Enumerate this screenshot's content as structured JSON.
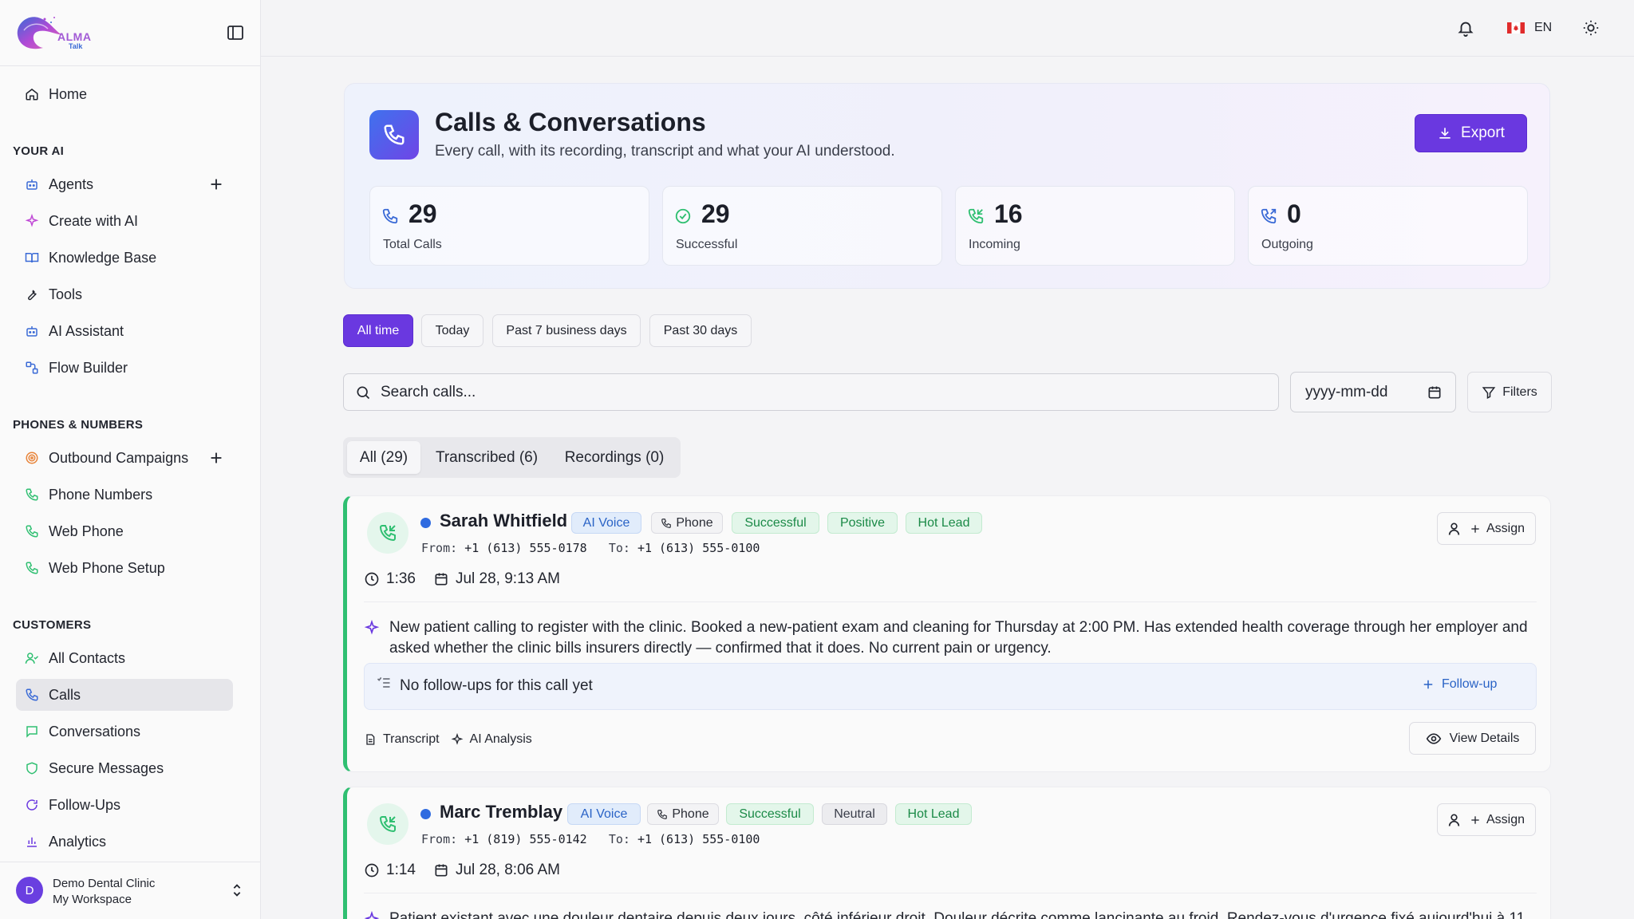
{
  "app": {
    "logo_text": "ALMA",
    "logo_sub": "Talk"
  },
  "sidebar": {
    "home": "Home",
    "section_ai": "YOUR AI",
    "ai_items": [
      "Agents",
      "Create with AI",
      "Knowledge Base",
      "Tools",
      "AI Assistant",
      "Flow Builder"
    ],
    "section_phones": "PHONES & NUMBERS",
    "phone_items": [
      "Outbound Campaigns",
      "Phone Numbers",
      "Web Phone",
      "Web Phone Setup"
    ],
    "section_customers": "CUSTOMERS",
    "customer_items": [
      "All Contacts",
      "Calls",
      "Conversations",
      "Secure Messages",
      "Follow-Ups",
      "Analytics"
    ],
    "active_item": "Calls",
    "workspace": {
      "initial": "D",
      "name": "Demo Dental Clinic",
      "sub": "My Workspace"
    }
  },
  "topbar": {
    "lang": "EN"
  },
  "header": {
    "title": "Calls & Conversations",
    "subtitle": "Every call, with its recording, transcript and what your AI understood.",
    "export_label": "Export",
    "stats": [
      {
        "value": "29",
        "label": "Total Calls",
        "icon": "phone-icon"
      },
      {
        "value": "29",
        "label": "Successful",
        "icon": "check-circle-icon"
      },
      {
        "value": "16",
        "label": "Incoming",
        "icon": "phone-incoming-icon"
      },
      {
        "value": "0",
        "label": "Outgoing",
        "icon": "phone-outgoing-icon"
      }
    ]
  },
  "ranges": [
    "All time",
    "Today",
    "Past 7 business days",
    "Past 30 days"
  ],
  "search": {
    "placeholder": "Search calls...",
    "date_placeholder": "yyyy-mm-dd",
    "filters_label": "Filters"
  },
  "tabs": [
    "All (29)",
    "Transcribed (6)",
    "Recordings (0)"
  ],
  "calls": [
    {
      "name": "Sarah Whitfield",
      "badges": [
        "AI Voice",
        "Phone",
        "Successful",
        "Positive",
        "Hot Lead"
      ],
      "from_label": "From:",
      "from": "+1 (613) 555-0178",
      "to_label": "To:",
      "to": "+1 (613) 555-0100",
      "duration": "1:36",
      "date": "Jul 28, 9:13 AM",
      "summary": "New patient calling to register with the clinic. Booked a new-patient exam and cleaning for Thursday at 2:00 PM. Has extended health coverage through her employer and asked whether the clinic bills insurers directly — confirmed that it does. No current pain or urgency.",
      "followups_text": "No follow-ups for this call yet",
      "followup_btn": "Follow-up",
      "transcript_label": "Transcript",
      "analysis_label": "AI Analysis",
      "view_label": "View Details",
      "assign_label": "Assign"
    },
    {
      "name": "Marc Tremblay",
      "badges": [
        "AI Voice",
        "Phone",
        "Successful",
        "Neutral",
        "Hot Lead"
      ],
      "from_label": "From:",
      "from": "+1 (819) 555-0142",
      "to_label": "To:",
      "to": "+1 (613) 555-0100",
      "duration": "1:14",
      "date": "Jul 28, 8:06 AM",
      "summary": "Patient existant avec une douleur dentaire depuis deux jours, côté inférieur droit. Douleur décrite comme lancinante au froid. Rendez-vous d'urgence fixé aujourd'hui à 11",
      "assign_label": "Assign"
    }
  ]
}
